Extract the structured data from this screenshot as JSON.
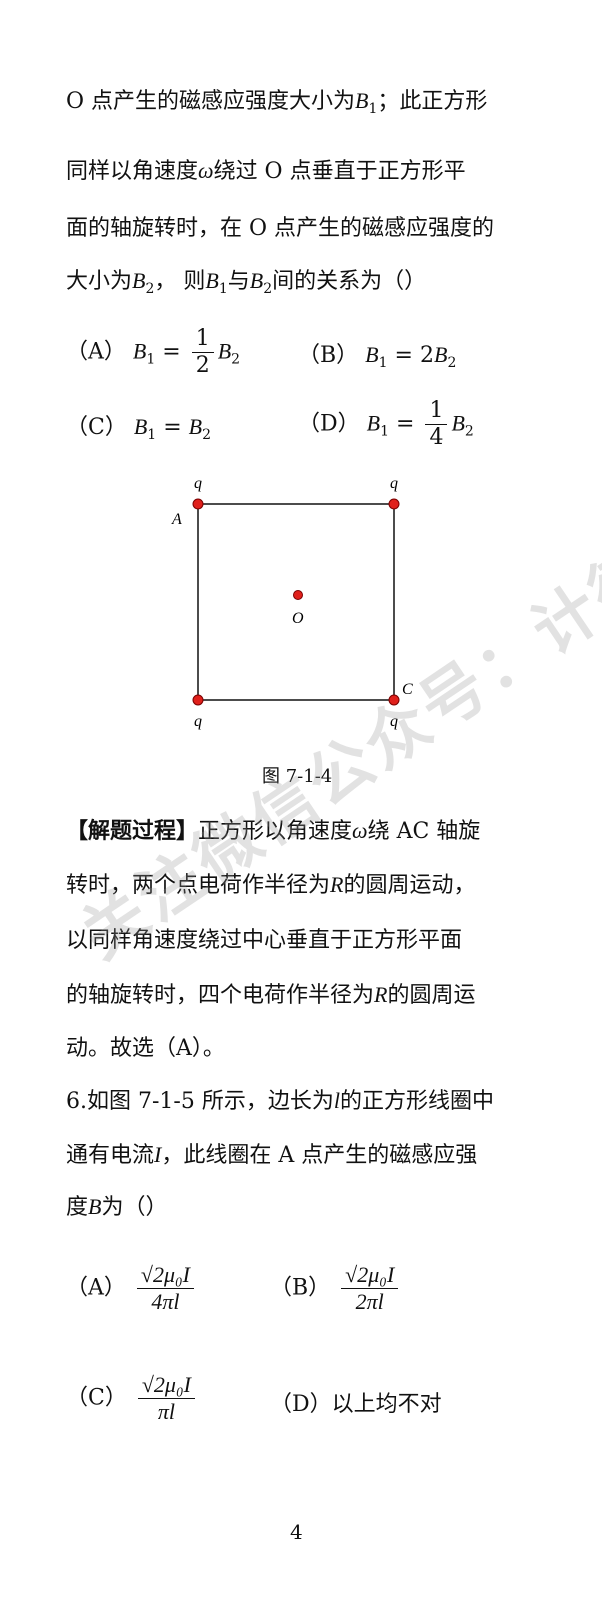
{
  "q5": {
    "line1": "O 点产生的磁感应强度大小为",
    "line1_end": "；此正方形",
    "line2a": "同样以角速度",
    "line2b": "绕过  O  点垂直于正方形平",
    "line3": "面的轴旋转时，在 O 点产生的磁感应强度的",
    "line4a": "大小为",
    "line4b": "， 则",
    "line4c": "与",
    "line4d": "间的关系为（）",
    "options": {
      "A_label": "（A）",
      "B_label": "（B）",
      "C_label": "（C）",
      "D_label": "（D）"
    }
  },
  "symbols": {
    "B": "B",
    "sub1": "1",
    "sub2": "2",
    "omega": "ω",
    "eq": "=",
    "one": "1",
    "two": "2",
    "four": "4",
    "twoB": "2B",
    "R": "R",
    "l": "l",
    "I": "I"
  },
  "figure": {
    "caption": "图 7-1-4",
    "labels": {
      "q_tl": "q",
      "q_tr": "q",
      "q_bl": "q",
      "q_br": "q",
      "A": "A",
      "C": "C",
      "O": "O"
    },
    "dot_color": "#e0201b"
  },
  "solution": {
    "title": "【解题过程】",
    "l1a": "正方形以角速度",
    "l1b": "绕 AC 轴旋",
    "l2a": "转时，两个点电荷作半径为",
    "l2b": "的圆周运动，",
    "l3": "以同样角速度绕过中心垂直于正方形平面",
    "l4a": "的轴旋转时，四个电荷作半径为",
    "l4b": "的圆周运",
    "l5": "动。故选（A）。"
  },
  "q6": {
    "l1a": "6.如图 7-1-5 所示，边长为",
    "l1b": "的正方形线圈中",
    "l2a": "通有电流",
    "l2b": "，此线圈在 A 点产生的磁感应强",
    "l3a": "度",
    "l3b": "为（）",
    "optA_label": "（A）",
    "optB_label": "（B）",
    "optC_label": "（C）",
    "optD_label": "（D）",
    "optD_text": "以上均不对",
    "frac_num": "√2μ₀I",
    "denA": "4πl",
    "denB": "2πl",
    "denC": "πl"
  },
  "watermark": "关注微信公众号：计德校园",
  "page_number": "4"
}
